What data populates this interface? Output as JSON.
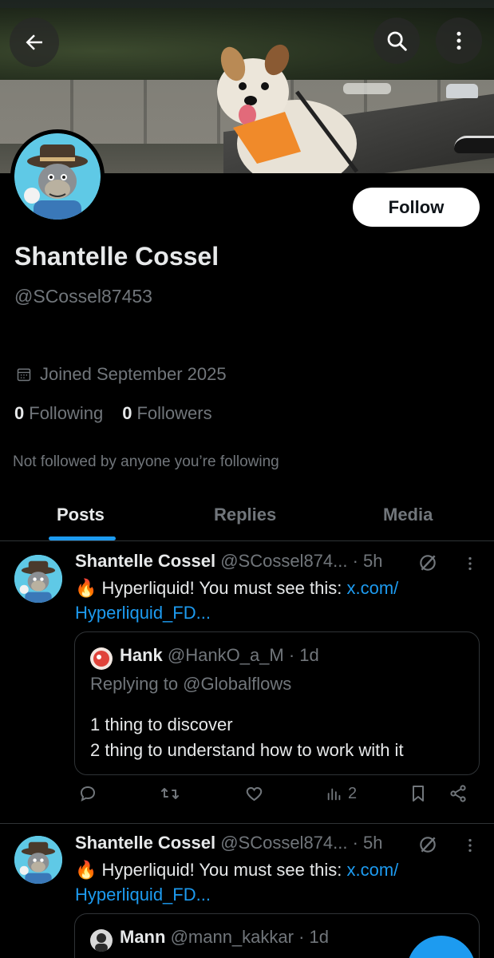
{
  "profile": {
    "name": "Shantelle Cossel",
    "handle": "@SCossel87453",
    "follow_label": "Follow",
    "joined": "Joined September 2025",
    "following_count": "0",
    "following_label": "Following",
    "followers_count": "0",
    "followers_label": "Followers",
    "not_followed": "Not followed by anyone you’re following"
  },
  "tabs": [
    {
      "label": "Posts"
    },
    {
      "label": "Replies"
    },
    {
      "label": "Media"
    }
  ],
  "posts": [
    {
      "name": "Shantelle Cossel",
      "meta": " @SCossel874... · 5h",
      "emoji": "🔥",
      "text": " Hyperliquid! You must see this: ",
      "link1": "x.com/",
      "link2": "Hyperliquid_FD...",
      "quote": {
        "name": "Hank",
        "meta": " @HankO_a_M · 1d",
        "reply": "Replying to @Globalflows",
        "line1": "1 thing to discover",
        "line2": "2 thing to understand how to work with it"
      },
      "views": "2"
    },
    {
      "name": "Shantelle Cossel",
      "meta": " @SCossel874... · 5h",
      "emoji": "🔥",
      "text": " Hyperliquid! You must see this: ",
      "link1": "x.com/",
      "link2": "Hyperliquid_FD...",
      "quote": {
        "name": "Mann",
        "meta": " @mann_kakkar · 1d"
      }
    }
  ],
  "icons": {
    "back": "back-arrow-icon",
    "search": "search-icon",
    "more": "more-vertical-icon",
    "calendar": "calendar-icon",
    "reply": "reply-icon",
    "retweet": "retweet-icon",
    "like": "heart-icon",
    "views": "views-icon",
    "bookmark": "bookmark-icon",
    "share": "share-icon",
    "muted": "slash-circle-icon"
  },
  "colors": {
    "accent": "#1d9bf0",
    "background": "#000000",
    "text": "#e7e9ea",
    "muted": "#71767b",
    "border": "#2f3336"
  }
}
